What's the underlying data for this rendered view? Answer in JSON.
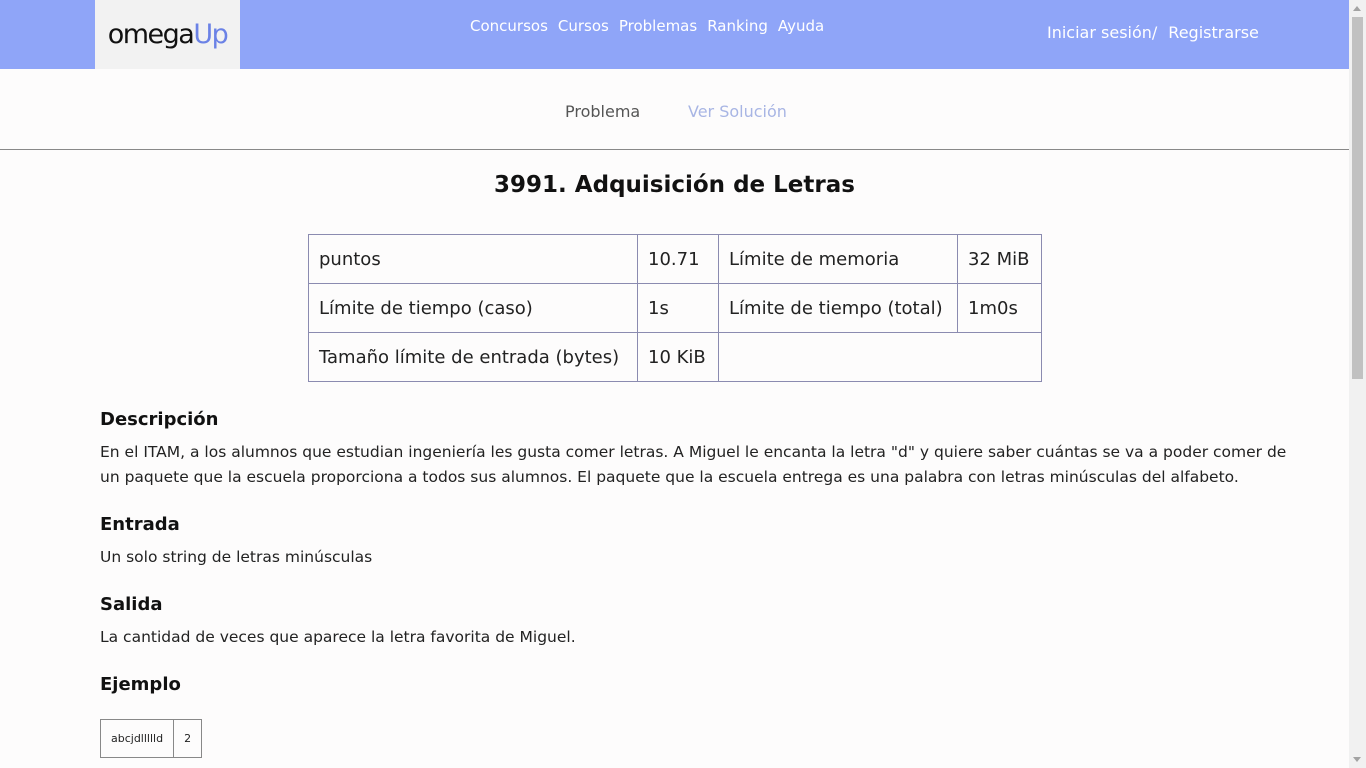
{
  "nav": {
    "logo_part1": "omega",
    "logo_part2": "Up",
    "links": [
      "Concursos",
      "Cursos",
      "Problemas",
      "Ranking",
      "Ayuda"
    ],
    "login": "Iniciar sesión/",
    "register": "Registrarse"
  },
  "tabs": {
    "problem": "Problema",
    "solution": "Ver Solución"
  },
  "problem": {
    "title": "3991. Adquisición de Letras",
    "table": {
      "r0c0": "puntos",
      "r0c1": "10.71",
      "r0c2": "Límite de memoria",
      "r0c3": "32 MiB",
      "r1c0": "Límite de tiempo (caso)",
      "r1c1": "1s",
      "r1c2": "Límite de tiempo (total)",
      "r1c3": "1m0s",
      "r2c0": "Tamaño límite de entrada (bytes)",
      "r2c1": "10 KiB"
    },
    "description_heading": "Descripción",
    "description": "En el ITAM, a los alumnos que estudian ingeniería les gusta comer letras. A Miguel le encanta la letra \"d\" y quiere saber cuántas se va a poder comer de un paquete que la escuela proporciona a todos sus alumnos. El paquete que la escuela entrega es una palabra con letras minúsculas del alfabeto.",
    "input_heading": "Entrada",
    "input": "Un solo string de letras minúsculas",
    "output_heading": "Salida",
    "output": "La cantidad de veces que aparece la letra favorita de Miguel.",
    "example_heading": "Ejemplo",
    "example_input": "abcjdllllld",
    "example_output": "2"
  },
  "colors": {
    "navbar": "#8fa5f8",
    "logo_accent": "#6b82e6",
    "solution_tab": "#a8b5e4"
  }
}
